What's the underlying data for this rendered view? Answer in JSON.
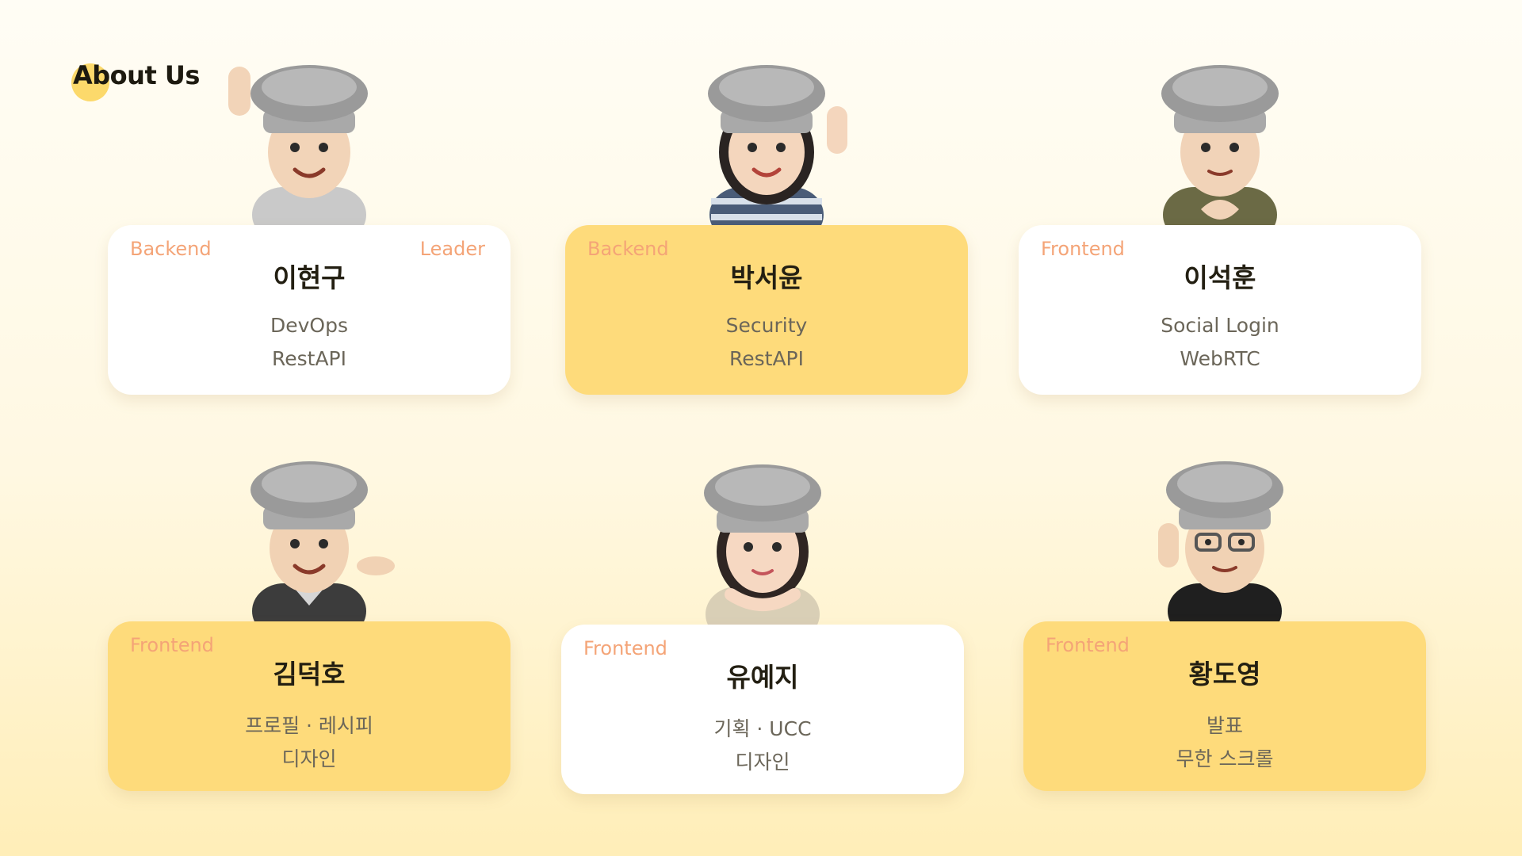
{
  "page": {
    "title": "About Us"
  },
  "members": [
    {
      "name": "이현구",
      "role": "Backend",
      "badge": "Leader",
      "skills": [
        "DevOps",
        "RestAPI"
      ],
      "card_color": "white"
    },
    {
      "name": "박서윤",
      "role": "Backend",
      "badge": "",
      "skills": [
        "Security",
        "RestAPI"
      ],
      "card_color": "yellow"
    },
    {
      "name": "이석훈",
      "role": "Frontend",
      "badge": "",
      "skills": [
        "Social Login",
        "WebRTC"
      ],
      "card_color": "white"
    },
    {
      "name": "김덕호",
      "role": "Frontend",
      "badge": "",
      "skills": [
        "프로필 · 레시피",
        "디자인"
      ],
      "card_color": "yellow"
    },
    {
      "name": "유예지",
      "role": "Frontend",
      "badge": "",
      "skills": [
        "기획 · UCC",
        "디자인"
      ],
      "card_color": "white"
    },
    {
      "name": "황도영",
      "role": "Frontend",
      "badge": "",
      "skills": [
        "발표",
        "무한 스크롤"
      ],
      "card_color": "yellow"
    }
  ],
  "colors": {
    "accent_yellow": "#fedb7b",
    "role_tag": "#f4a477",
    "name_text": "#231f12",
    "skill_text": "#6b6659"
  },
  "icons": [
    "chef-avatar-icon"
  ]
}
